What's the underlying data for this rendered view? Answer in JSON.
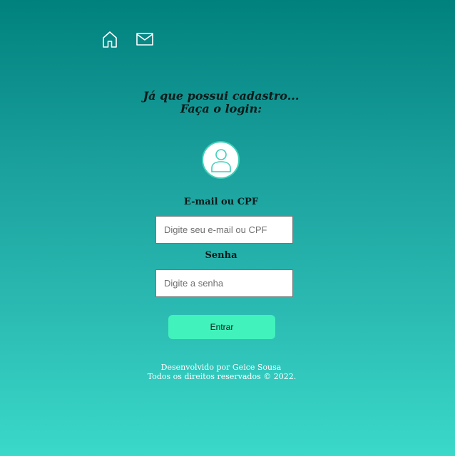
{
  "nav": {
    "home_icon": "home-icon",
    "mail_icon": "mail-icon"
  },
  "heading": {
    "line1": "Já que possui cadastro...",
    "line2": "Faça o login:"
  },
  "avatar": {
    "icon": "user-icon"
  },
  "form": {
    "email_label": "E-mail ou CPF",
    "email_placeholder": "Digite seu e-mail ou CPF",
    "password_label": "Senha",
    "password_placeholder": "Digite a senha",
    "submit_label": "Entrar"
  },
  "footer": {
    "line1": "Desenvolvido por Geice Sousa",
    "line2": "Todos os direitos reservados © 2022."
  },
  "colors": {
    "button": "#41f2bd",
    "avatar_border": "#3fcfb9",
    "gradient_top": "#00817e",
    "gradient_bottom": "#3ad9c9"
  }
}
